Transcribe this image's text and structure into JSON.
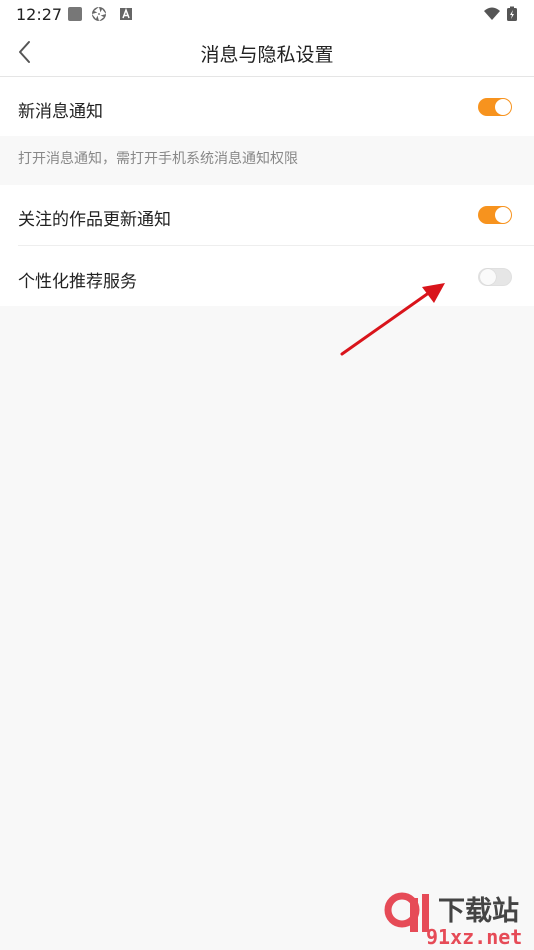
{
  "status_bar": {
    "time": "12:27"
  },
  "header": {
    "title": "消息与隐私设置",
    "back_icon": "chevron-left-icon"
  },
  "settings": [
    {
      "label": "新消息通知",
      "enabled": true
    },
    {
      "label": "关注的作品更新通知",
      "enabled": true
    },
    {
      "label": "个性化推荐服务",
      "enabled": false
    }
  ],
  "notification_hint": "打开消息通知，需打开手机系统消息通知权限",
  "colors": {
    "accent": "#f7931e",
    "page_bg": "#f8f8f8",
    "annotation_arrow": "#d9141b"
  },
  "watermark": {
    "text_cn": "下载站",
    "text_en": "91xz.net",
    "logo": "91"
  }
}
